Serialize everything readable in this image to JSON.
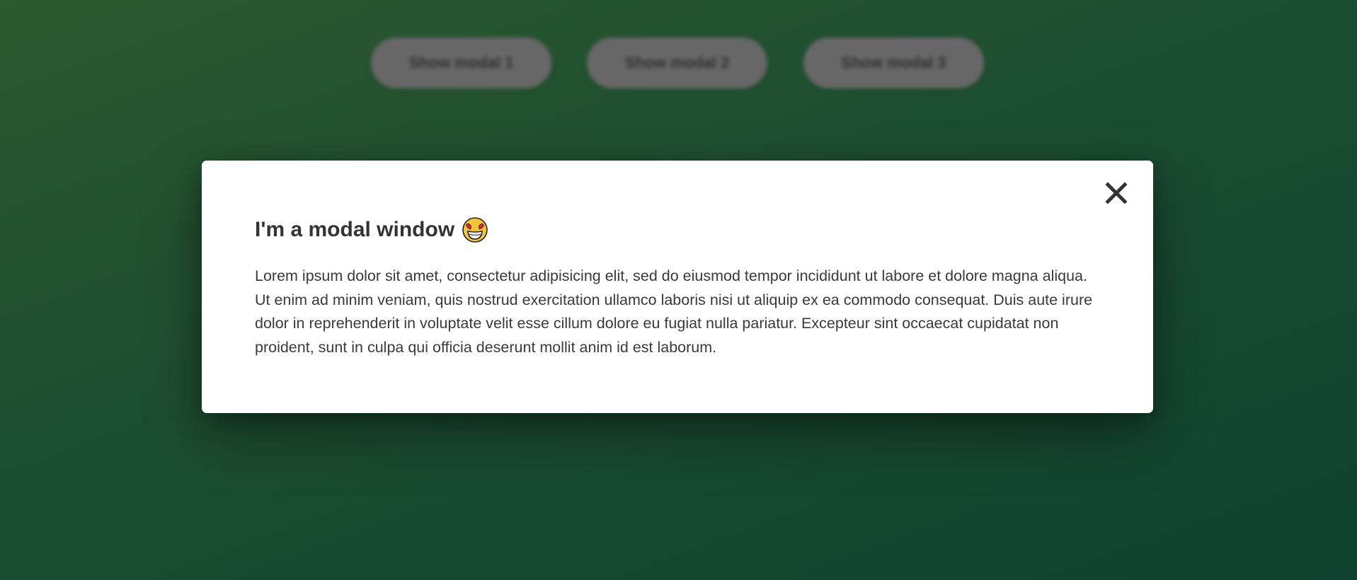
{
  "buttons": [
    {
      "label": "Show modal 1"
    },
    {
      "label": "Show modal 2"
    },
    {
      "label": "Show modal 3"
    }
  ],
  "modal": {
    "title": "I'm a modal window",
    "title_emoji": "smiling-face-with-heart-eyes-icon",
    "close_icon": "close-icon",
    "body": "Lorem ipsum dolor sit amet, consectetur adipisicing elit, sed do eiusmod tempor incididunt ut labore et dolore magna aliqua. Ut enim ad minim veniam, quis nostrud exercitation ullamco laboris nisi ut aliquip ex ea commodo consequat. Duis aute irure dolor in reprehenderit in voluptate velit esse cillum dolore eu fugiat nulla pariatur. Excepteur sint occaecat cupidatat non proident, sunt in culpa qui officia deserunt mollit anim id est laborum."
  },
  "colors": {
    "background_start": "#2f5f32",
    "background_end": "#114634",
    "button_bg": "#6e6e6e",
    "text": "#333333",
    "modal_bg": "#ffffff"
  }
}
